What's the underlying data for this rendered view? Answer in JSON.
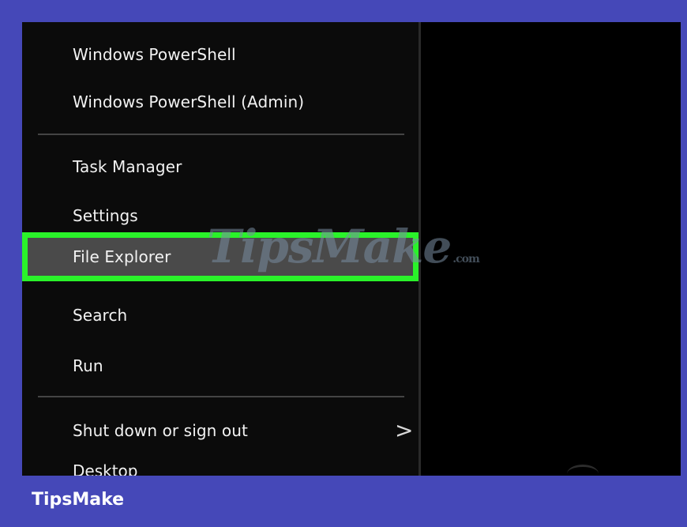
{
  "menu": {
    "items": [
      {
        "label": "Windows PowerShell"
      },
      {
        "label": "Windows PowerShell (Admin)"
      },
      {
        "label": "Task Manager"
      },
      {
        "label": "Settings"
      },
      {
        "label": "File Explorer"
      },
      {
        "label": "Search"
      },
      {
        "label": "Run"
      },
      {
        "label": "Shut down or sign out"
      },
      {
        "label": "Desktop"
      }
    ],
    "highlighted_item": "File Explorer",
    "submenu_chevron": ">"
  },
  "watermark": {
    "text": "TipsMake",
    "suffix": ".com"
  },
  "footer": {
    "brand": "TipsMake"
  },
  "colors": {
    "frame": "#4548b8",
    "highlight_border": "#2af22a",
    "menu_bg": "#0b0b0b",
    "text": "#f2f2f2"
  }
}
